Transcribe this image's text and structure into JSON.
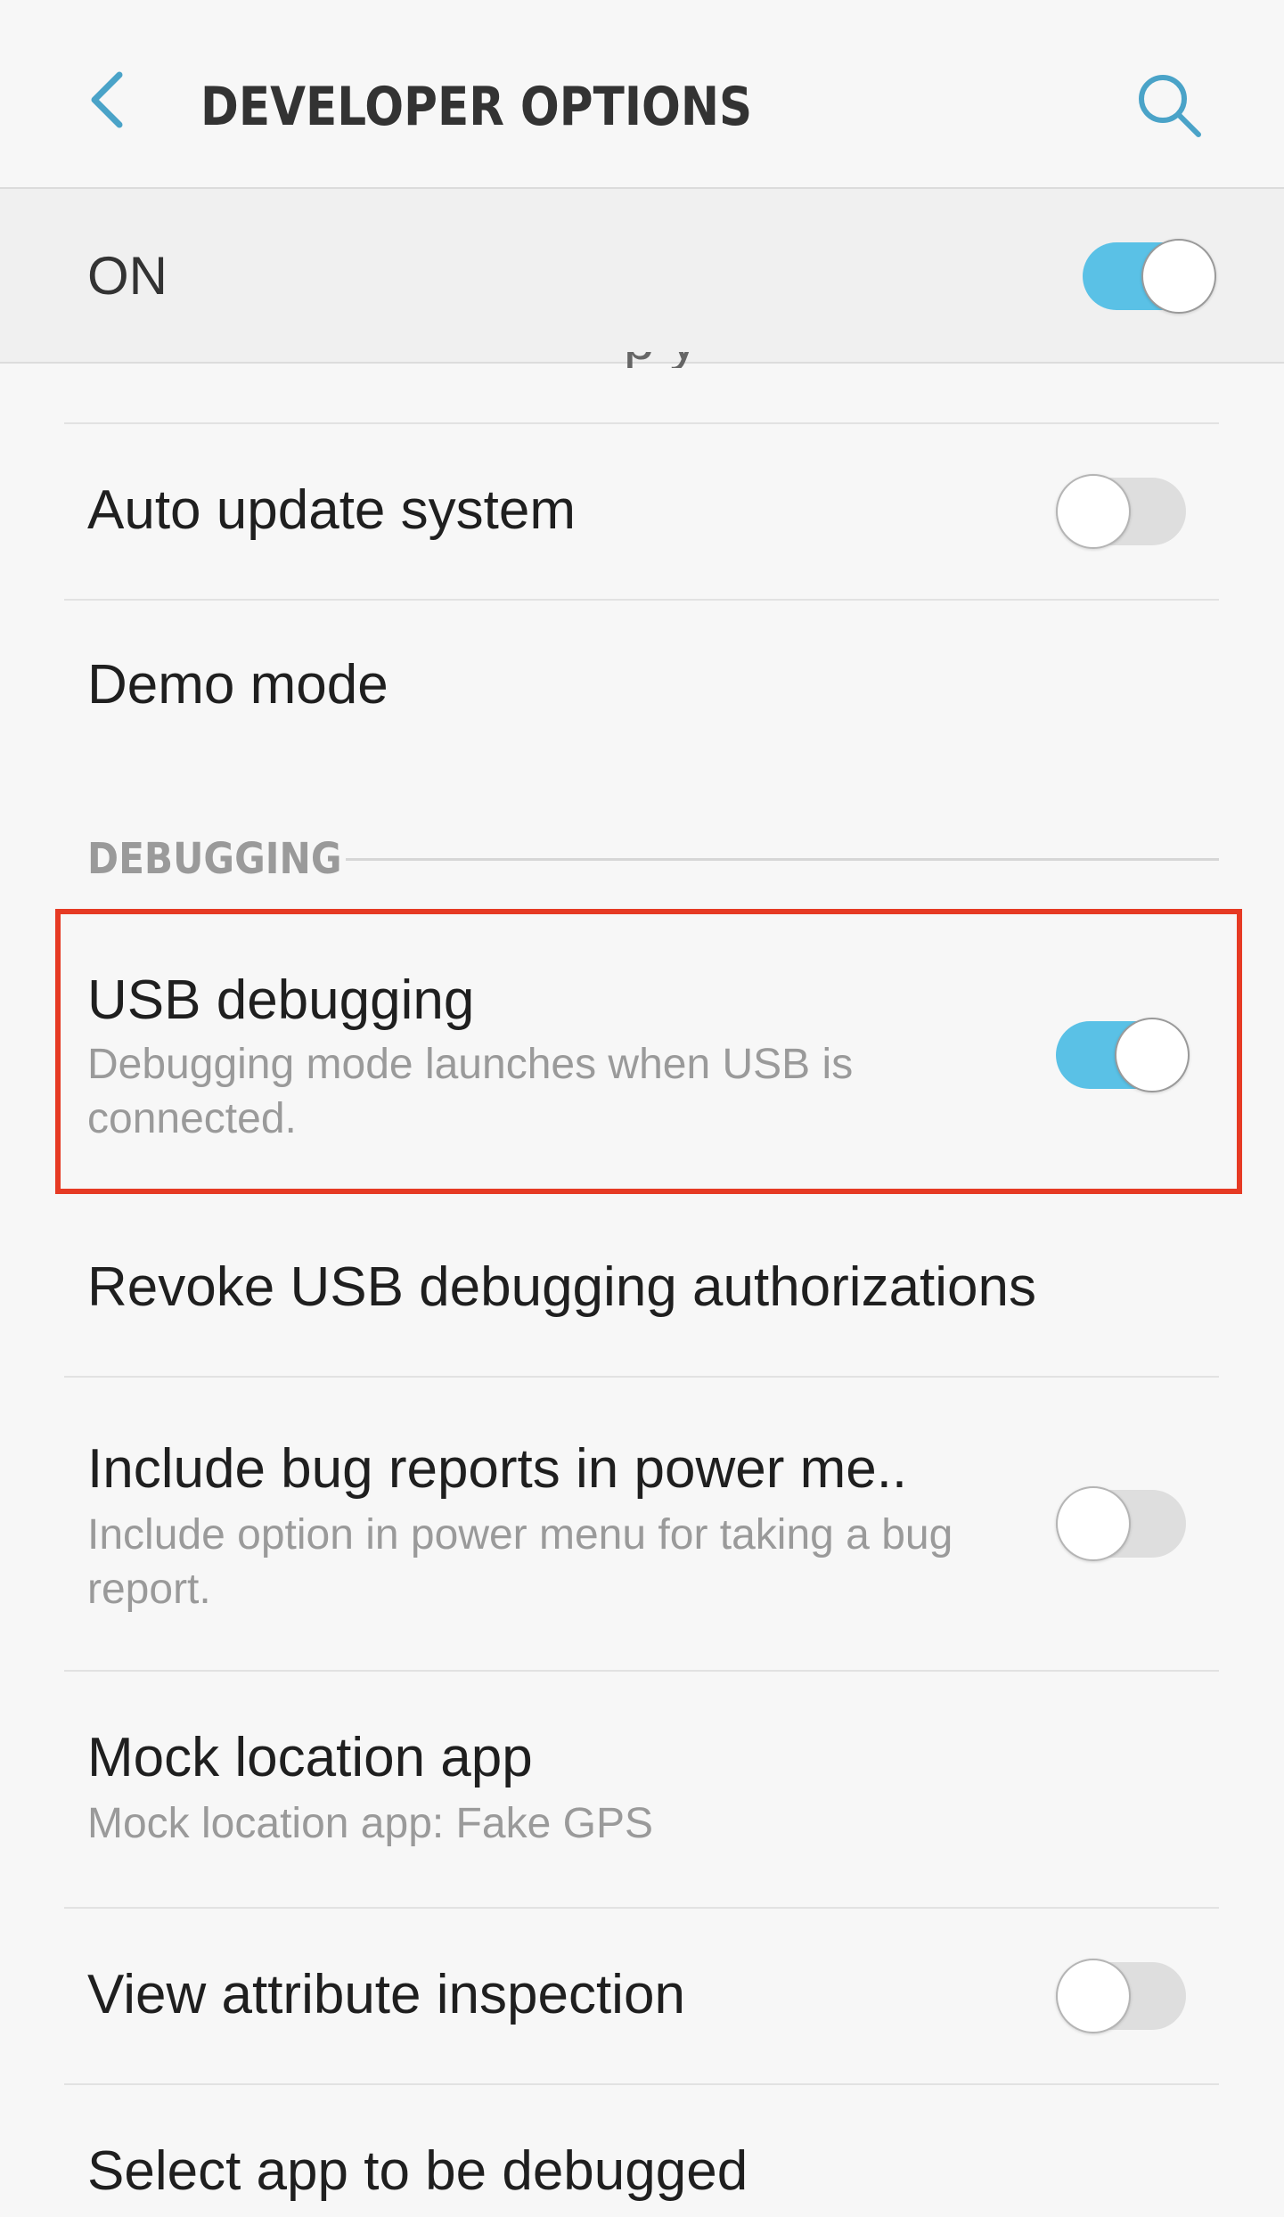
{
  "header": {
    "title": "DEVELOPER OPTIONS",
    "back_icon": "chevron-left-icon",
    "search_icon": "search-icon",
    "accent_color": "#4aa3c8"
  },
  "master_switch": {
    "label": "ON",
    "enabled": true
  },
  "clipped_row": {
    "partial_text": "p y"
  },
  "items": [
    {
      "title": "Auto update system",
      "toggle": false
    },
    {
      "title": "Demo mode"
    }
  ],
  "debugging": {
    "section_label": "DEBUGGING",
    "items": [
      {
        "title": "USB debugging",
        "subtitle": "Debugging mode launches when USB is connected.",
        "toggle": true,
        "highlighted": true
      },
      {
        "title": "Revoke USB debugging authorizations"
      },
      {
        "title": "Include bug reports in power me..",
        "subtitle": "Include option in power menu for taking a bug report.",
        "toggle": false
      },
      {
        "title": "Mock location app",
        "subtitle": "Mock location app: Fake GPS"
      },
      {
        "title": "View attribute inspection",
        "toggle": false
      },
      {
        "title": "Select app to be debugged"
      }
    ]
  },
  "colors": {
    "toggle_on": "#5ac1e6",
    "toggle_off": "#dedede",
    "highlight_border": "#e63a24",
    "background": "#f7f7f7"
  }
}
